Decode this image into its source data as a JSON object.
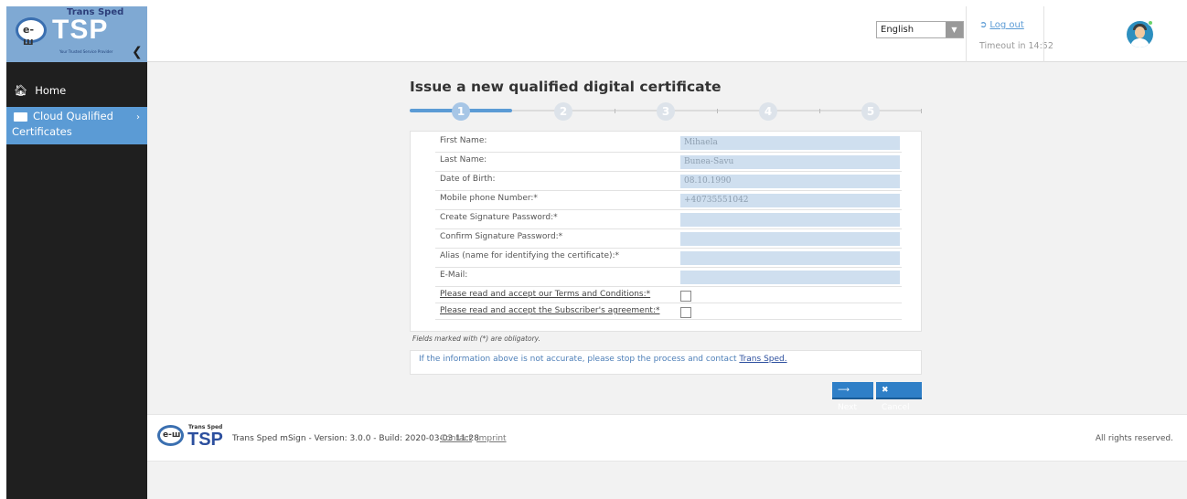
{
  "sidebar": {
    "logo": {
      "brand": "Trans Sped",
      "mark": "TSP",
      "tagline": "Your Trusted Service Provider",
      "circle_text": "e-ш"
    },
    "items": [
      {
        "label": "Home",
        "icon": "home-icon"
      },
      {
        "label": "Cloud Qualified",
        "label2": "Certificates",
        "icon": "id-card-icon",
        "active": true
      }
    ]
  },
  "header": {
    "language": "English",
    "logout_label": "Log out",
    "timeout_label": "Timeout in 14:52"
  },
  "main": {
    "title": "Issue a new qualified digital certificate",
    "steps": [
      "1",
      "2",
      "3",
      "4",
      "5"
    ],
    "active_step": 1,
    "fields": [
      {
        "label": "First Name:",
        "value": "Mihaela"
      },
      {
        "label": "Last Name:",
        "value": "Bunea-Savu"
      },
      {
        "label": "Date of Birth:",
        "value": "08.10.1990"
      },
      {
        "label": "Mobile phone Number:*",
        "value": "+40735551042"
      },
      {
        "label": "Create Signature Password:*",
        "value": ""
      },
      {
        "label": "Confirm Signature Password:*",
        "value": ""
      },
      {
        "label": "Alias (name for identifying the certificate):*",
        "value": ""
      },
      {
        "label": "E-Mail:",
        "value": ""
      }
    ],
    "checkboxes": [
      {
        "label": "Please read and accept our Terms and Conditions:*"
      },
      {
        "label": "Please read and accept the Subscriber's agreement:*"
      }
    ],
    "obligatory_note": "Fields marked with (*) are obligatory.",
    "info_text": "If the information above is not accurate, please stop the process and contact ",
    "info_link": "Trans Sped.",
    "next_label": "Next",
    "cancel_label": "Cancel"
  },
  "footer": {
    "brand": "Trans Sped",
    "mark": "TSP",
    "circle_text": "e-ш",
    "version_text": "Trans Sped mSign - Version: 3.0.0 - Build: 2020-03-03 11:28",
    "contact": "Contact",
    "imprint": "Imprint",
    "rights": "All rights reserved."
  },
  "colors": {
    "accent": "#5b9bd5",
    "button": "#2f7fc7",
    "sidebar": "#1f1f1f",
    "logo_bg": "#7fa9d3",
    "input_bg": "#cfdfef"
  }
}
